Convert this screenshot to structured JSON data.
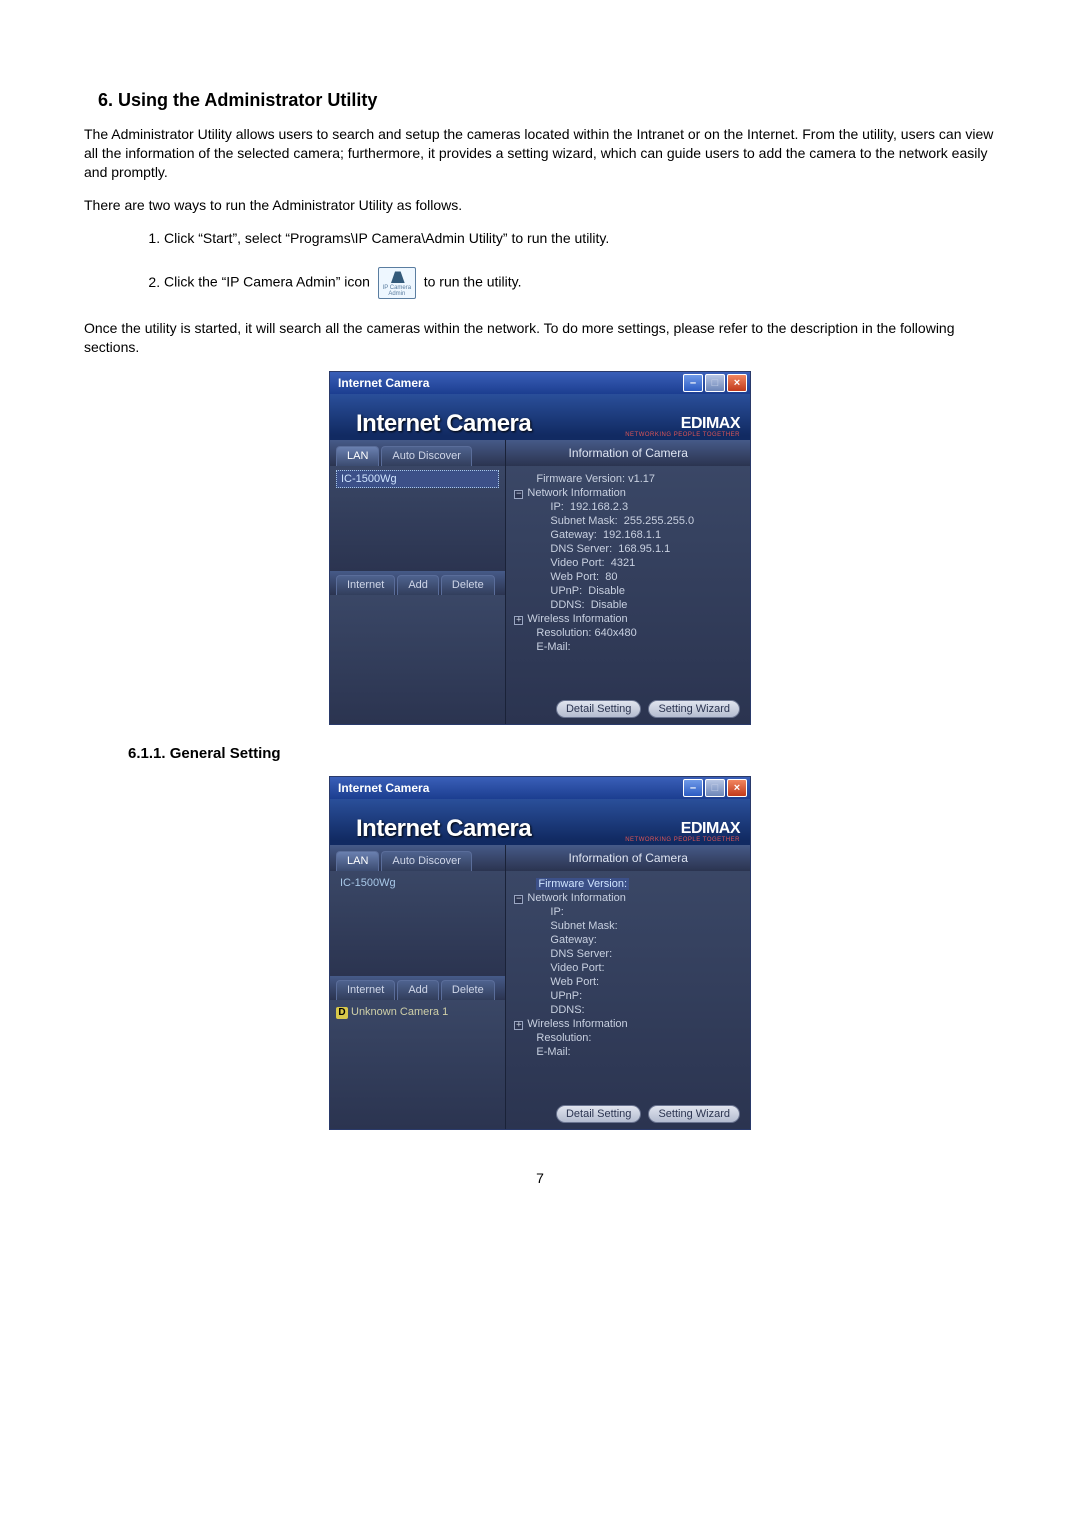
{
  "headings": {
    "section": "6.  Using the Administrator Utility",
    "subsection": "6.1.1.    General Setting"
  },
  "paragraphs": {
    "p1": "The Administrator Utility allows users to search and setup the cameras located within the Intranet or on the Internet. From the utility, users can view all the information of the selected camera; furthermore, it provides a setting wizard, which can guide users to add the camera to the network easily and promptly.",
    "p2": "There are two ways to run the Administrator Utility as follows.",
    "p3": "Once the utility is started, it will search all the cameras within the network. To do more settings, please refer to the description in the following sections."
  },
  "list": {
    "i1": "Click “Start”, select “Programs\\IP Camera\\Admin Utility” to run the utility.",
    "i2a": "Click the “IP Camera Admin” icon",
    "i2b": "to run the utility.",
    "iconCaption": "IP Camera Admin"
  },
  "window": {
    "title": "Internet Camera",
    "bannerTitle": "Internet Camera",
    "logo": "EDIMAX",
    "logoTag": "NETWORKING PEOPLE TOGETHER",
    "tabs": {
      "lan": "LAN",
      "autoDiscover": "Auto Discover"
    },
    "infoHeader": "Information of Camera",
    "subtabs": {
      "internet": "Internet",
      "add": "Add",
      "del": "Delete"
    },
    "btn": {
      "detail": "Detail Setting",
      "wizard": "Setting Wizard"
    },
    "winbtn": {
      "min": "–",
      "max": "□",
      "close": "×"
    }
  },
  "shot1": {
    "lanItem": "IC-1500Wg",
    "tree": {
      "firmware": "Firmware Version: v1.17",
      "netinfo": "Network Information",
      "ip": "IP:  192.168.2.3",
      "subnet": "Subnet Mask:  255.255.255.0",
      "gateway": "Gateway:  192.168.1.1",
      "dns": "DNS Server:  168.95.1.1",
      "vport": "Video Port:  4321",
      "wport": "Web Port:  80",
      "upnp": "UPnP:  Disable",
      "ddns": "DDNS:  Disable",
      "wireless": "Wireless Information",
      "res": "Resolution: 640x480",
      "email": "E-Mail:"
    }
  },
  "shot2": {
    "lanItem": "IC-1500Wg",
    "internetItem": "Unknown Camera 1",
    "tree": {
      "firmware": "Firmware Version:",
      "netinfo": "Network Information",
      "ip": "IP:",
      "subnet": "Subnet Mask:",
      "gateway": "Gateway:",
      "dns": "DNS Server:",
      "vport": "Video Port:",
      "wport": "Web Port:",
      "upnp": "UPnP:",
      "ddns": "DDNS:",
      "wireless": "Wireless Information",
      "res": "Resolution:",
      "email": "E-Mail:"
    }
  },
  "pageNumber": "7"
}
